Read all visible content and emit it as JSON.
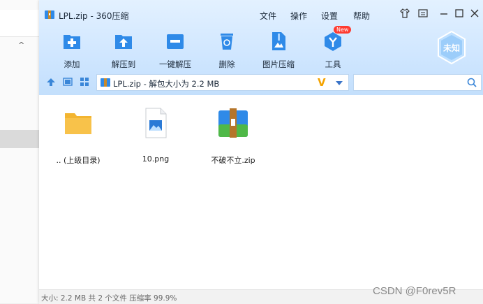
{
  "window": {
    "title": "LPL.zip - 360压缩",
    "menu": [
      "文件",
      "操作",
      "设置",
      "帮助"
    ]
  },
  "toolbar": {
    "items": [
      {
        "label": "添加",
        "icon": "add-icon"
      },
      {
        "label": "解压到",
        "icon": "extract-to-icon"
      },
      {
        "label": "一键解压",
        "icon": "one-click-extract-icon"
      },
      {
        "label": "删除",
        "icon": "delete-icon"
      },
      {
        "label": "图片压缩",
        "icon": "image-compress-icon"
      },
      {
        "label": "工具",
        "icon": "tools-icon"
      }
    ],
    "new_badge": "New",
    "brand_label": "未知"
  },
  "address": {
    "path": "LPL.zip - 解包大小为 2.2 MB",
    "search_placeholder": ""
  },
  "files": [
    {
      "name": ".. (上级目录)",
      "icon": "folder-icon"
    },
    {
      "name": "10.png",
      "icon": "image-file-icon"
    },
    {
      "name": "不破不立.zip",
      "icon": "zip-archive-icon"
    }
  ],
  "status": "大小: 2.2 MB 共 2 个文件 压缩率 99.9%",
  "watermark": "CSDN @F0rev5R",
  "colors": {
    "titlebar": "#cfe6ff",
    "accent_blue": "#2f8ae8",
    "folder_yellow": "#f8c24a"
  }
}
